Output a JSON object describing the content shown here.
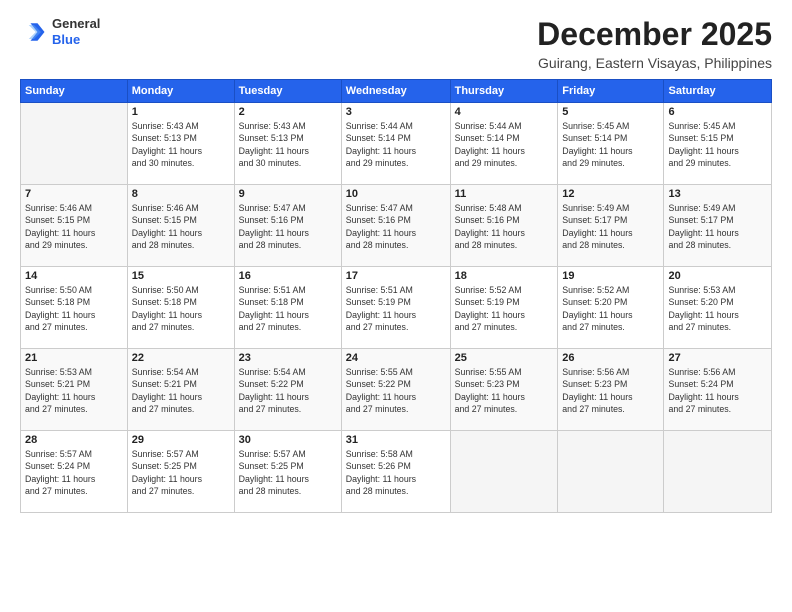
{
  "logo": {
    "general": "General",
    "blue": "Blue"
  },
  "header": {
    "month": "December 2025",
    "location": "Guirang, Eastern Visayas, Philippines"
  },
  "weekdays": [
    "Sunday",
    "Monday",
    "Tuesday",
    "Wednesday",
    "Thursday",
    "Friday",
    "Saturday"
  ],
  "weeks": [
    [
      {
        "day": "",
        "info": ""
      },
      {
        "day": "1",
        "info": "Sunrise: 5:43 AM\nSunset: 5:13 PM\nDaylight: 11 hours\nand 30 minutes."
      },
      {
        "day": "2",
        "info": "Sunrise: 5:43 AM\nSunset: 5:13 PM\nDaylight: 11 hours\nand 30 minutes."
      },
      {
        "day": "3",
        "info": "Sunrise: 5:44 AM\nSunset: 5:14 PM\nDaylight: 11 hours\nand 29 minutes."
      },
      {
        "day": "4",
        "info": "Sunrise: 5:44 AM\nSunset: 5:14 PM\nDaylight: 11 hours\nand 29 minutes."
      },
      {
        "day": "5",
        "info": "Sunrise: 5:45 AM\nSunset: 5:14 PM\nDaylight: 11 hours\nand 29 minutes."
      },
      {
        "day": "6",
        "info": "Sunrise: 5:45 AM\nSunset: 5:15 PM\nDaylight: 11 hours\nand 29 minutes."
      }
    ],
    [
      {
        "day": "7",
        "info": "Sunrise: 5:46 AM\nSunset: 5:15 PM\nDaylight: 11 hours\nand 29 minutes."
      },
      {
        "day": "8",
        "info": "Sunrise: 5:46 AM\nSunset: 5:15 PM\nDaylight: 11 hours\nand 28 minutes."
      },
      {
        "day": "9",
        "info": "Sunrise: 5:47 AM\nSunset: 5:16 PM\nDaylight: 11 hours\nand 28 minutes."
      },
      {
        "day": "10",
        "info": "Sunrise: 5:47 AM\nSunset: 5:16 PM\nDaylight: 11 hours\nand 28 minutes."
      },
      {
        "day": "11",
        "info": "Sunrise: 5:48 AM\nSunset: 5:16 PM\nDaylight: 11 hours\nand 28 minutes."
      },
      {
        "day": "12",
        "info": "Sunrise: 5:49 AM\nSunset: 5:17 PM\nDaylight: 11 hours\nand 28 minutes."
      },
      {
        "day": "13",
        "info": "Sunrise: 5:49 AM\nSunset: 5:17 PM\nDaylight: 11 hours\nand 28 minutes."
      }
    ],
    [
      {
        "day": "14",
        "info": "Sunrise: 5:50 AM\nSunset: 5:18 PM\nDaylight: 11 hours\nand 27 minutes."
      },
      {
        "day": "15",
        "info": "Sunrise: 5:50 AM\nSunset: 5:18 PM\nDaylight: 11 hours\nand 27 minutes."
      },
      {
        "day": "16",
        "info": "Sunrise: 5:51 AM\nSunset: 5:18 PM\nDaylight: 11 hours\nand 27 minutes."
      },
      {
        "day": "17",
        "info": "Sunrise: 5:51 AM\nSunset: 5:19 PM\nDaylight: 11 hours\nand 27 minutes."
      },
      {
        "day": "18",
        "info": "Sunrise: 5:52 AM\nSunset: 5:19 PM\nDaylight: 11 hours\nand 27 minutes."
      },
      {
        "day": "19",
        "info": "Sunrise: 5:52 AM\nSunset: 5:20 PM\nDaylight: 11 hours\nand 27 minutes."
      },
      {
        "day": "20",
        "info": "Sunrise: 5:53 AM\nSunset: 5:20 PM\nDaylight: 11 hours\nand 27 minutes."
      }
    ],
    [
      {
        "day": "21",
        "info": "Sunrise: 5:53 AM\nSunset: 5:21 PM\nDaylight: 11 hours\nand 27 minutes."
      },
      {
        "day": "22",
        "info": "Sunrise: 5:54 AM\nSunset: 5:21 PM\nDaylight: 11 hours\nand 27 minutes."
      },
      {
        "day": "23",
        "info": "Sunrise: 5:54 AM\nSunset: 5:22 PM\nDaylight: 11 hours\nand 27 minutes."
      },
      {
        "day": "24",
        "info": "Sunrise: 5:55 AM\nSunset: 5:22 PM\nDaylight: 11 hours\nand 27 minutes."
      },
      {
        "day": "25",
        "info": "Sunrise: 5:55 AM\nSunset: 5:23 PM\nDaylight: 11 hours\nand 27 minutes."
      },
      {
        "day": "26",
        "info": "Sunrise: 5:56 AM\nSunset: 5:23 PM\nDaylight: 11 hours\nand 27 minutes."
      },
      {
        "day": "27",
        "info": "Sunrise: 5:56 AM\nSunset: 5:24 PM\nDaylight: 11 hours\nand 27 minutes."
      }
    ],
    [
      {
        "day": "28",
        "info": "Sunrise: 5:57 AM\nSunset: 5:24 PM\nDaylight: 11 hours\nand 27 minutes."
      },
      {
        "day": "29",
        "info": "Sunrise: 5:57 AM\nSunset: 5:25 PM\nDaylight: 11 hours\nand 27 minutes."
      },
      {
        "day": "30",
        "info": "Sunrise: 5:57 AM\nSunset: 5:25 PM\nDaylight: 11 hours\nand 28 minutes."
      },
      {
        "day": "31",
        "info": "Sunrise: 5:58 AM\nSunset: 5:26 PM\nDaylight: 11 hours\nand 28 minutes."
      },
      {
        "day": "",
        "info": ""
      },
      {
        "day": "",
        "info": ""
      },
      {
        "day": "",
        "info": ""
      }
    ]
  ]
}
